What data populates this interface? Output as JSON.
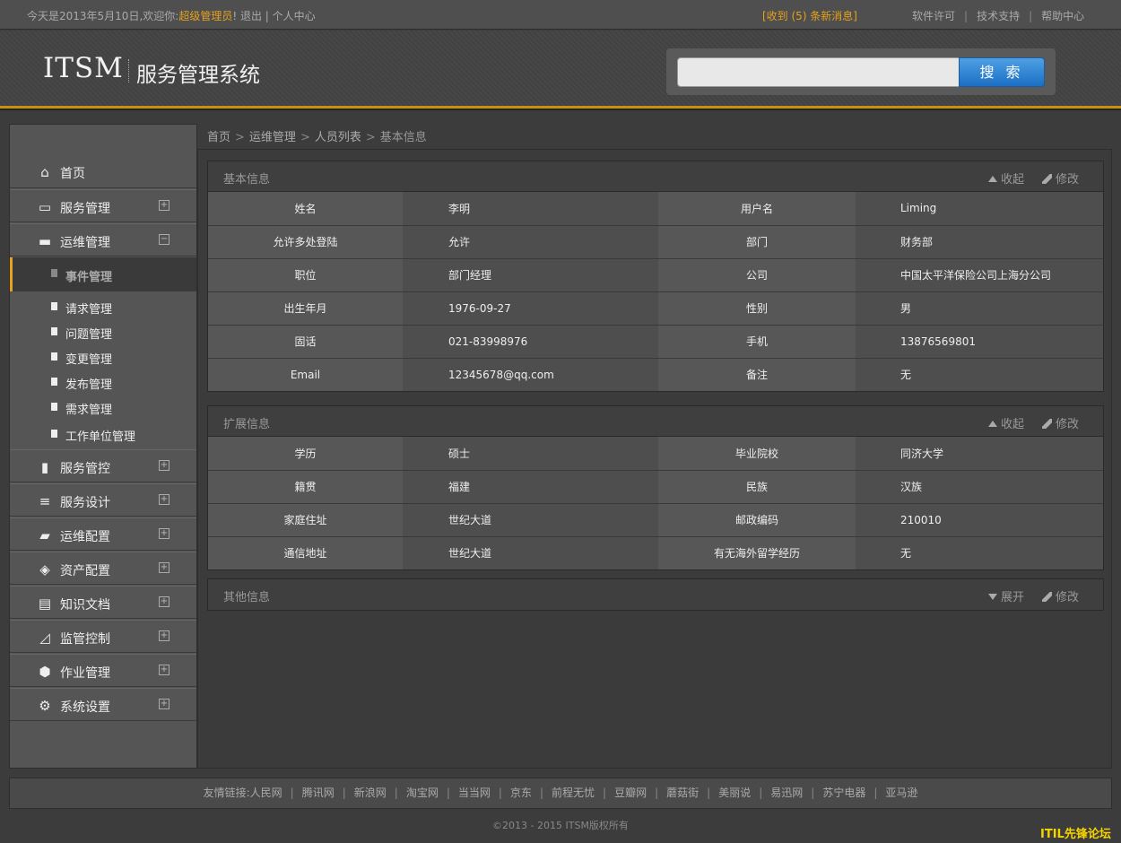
{
  "topbar": {
    "greeting": "今天是2013年5月10日,欢迎你:",
    "admin": "超级管理员",
    "after_admin": "! 退出 | 个人中心",
    "messages": "[收到 (5) 条新消息]",
    "links": [
      "软件许可",
      "技术支持",
      "帮助中心"
    ]
  },
  "header": {
    "logo": "ITSM",
    "system_name": "服务管理系统",
    "search_placeholder": "",
    "search_button": "搜 索"
  },
  "sidebar": {
    "items": [
      {
        "label": "首页",
        "icon": "home-icon",
        "toggle": ""
      },
      {
        "label": "服务管理",
        "icon": "device-icon",
        "toggle": "+"
      },
      {
        "label": "运维管理",
        "icon": "folder-open-icon",
        "toggle": "−"
      },
      {
        "label": "服务管控",
        "icon": "bar-chart-icon",
        "toggle": "+"
      },
      {
        "label": "服务设计",
        "icon": "database-icon",
        "toggle": "+"
      },
      {
        "label": "运维配置",
        "icon": "folder-plus-icon",
        "toggle": "+"
      },
      {
        "label": "资产配置",
        "icon": "layers-icon",
        "toggle": "+"
      },
      {
        "label": "知识文档",
        "icon": "clipboard-icon",
        "toggle": "+"
      },
      {
        "label": "监管控制",
        "icon": "line-chart-icon",
        "toggle": "+"
      },
      {
        "label": "作业管理",
        "icon": "cube-icon",
        "toggle": "+"
      },
      {
        "label": "系统设置",
        "icon": "gear-icon",
        "toggle": "+"
      }
    ],
    "subitems": [
      "事件管理",
      "请求管理",
      "问题管理",
      "变更管理",
      "发布管理",
      "需求管理",
      "工作单位管理"
    ]
  },
  "breadcrumb": [
    "首页",
    "运维管理",
    "人员列表",
    "基本信息"
  ],
  "panels": {
    "basic": {
      "title": "基本信息",
      "collapse": "收起",
      "edit": "修改",
      "rows": [
        [
          "姓名",
          "李明",
          "用户名",
          "Liming"
        ],
        [
          "允许多处登陆",
          "允许",
          "部门",
          "财务部"
        ],
        [
          "职位",
          "部门经理",
          "公司",
          "中国太平洋保险公司上海分公司"
        ],
        [
          "出生年月",
          "1976-09-27",
          "性别",
          "男"
        ],
        [
          "固话",
          "021-83998976",
          "手机",
          "13876569801"
        ],
        [
          "Email",
          "12345678@qq.com",
          "备注",
          "无"
        ]
      ]
    },
    "extended": {
      "title": "扩展信息",
      "collapse": "收起",
      "edit": "修改",
      "rows": [
        [
          "学历",
          "硕士",
          "毕业院校",
          "同济大学"
        ],
        [
          "籍贯",
          "福建",
          "民族",
          "汉族"
        ],
        [
          "家庭住址",
          "世纪大道",
          "邮政编码",
          "210010"
        ],
        [
          "通信地址",
          "世纪大道",
          "有无海外留学经历",
          "无"
        ]
      ]
    },
    "other": {
      "title": "其他信息",
      "expand": "展开",
      "edit": "修改"
    }
  },
  "footer": {
    "friends_label": "友情链接:",
    "friends": [
      "人民网",
      "腾讯网",
      "新浪网",
      "淘宝网",
      "当当网",
      "京东",
      "前程无忧",
      "豆瓣网",
      "蘑菇街",
      "美丽说",
      "易迅网",
      "苏宁电器",
      "亚马逊"
    ],
    "copyright": "©2013 - 2015 ITSM版权所有",
    "forum": "ITIL先锋论坛"
  }
}
